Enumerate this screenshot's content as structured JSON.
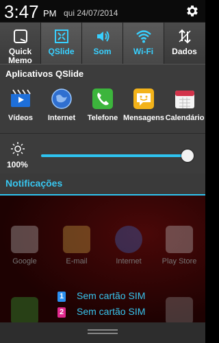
{
  "status": {
    "time": "3:47",
    "ampm": "PM",
    "date": "qui 24/07/2014"
  },
  "toggles": [
    {
      "label_lines": [
        "Quick",
        "Memo"
      ],
      "icon": "quick-memo-icon",
      "active": false
    },
    {
      "label_lines": [
        "QSlide"
      ],
      "icon": "qslide-icon",
      "active": true
    },
    {
      "label_lines": [
        "Som"
      ],
      "icon": "sound-icon",
      "active": true
    },
    {
      "label_lines": [
        "Wi-Fi"
      ],
      "icon": "wifi-icon",
      "active": true
    },
    {
      "label_lines": [
        "Dados"
      ],
      "icon": "data-icon",
      "active": false
    }
  ],
  "qslide": {
    "title": "Aplicativos QSlide",
    "apps": [
      {
        "label": "Vídeos",
        "icon": "videos-icon"
      },
      {
        "label": "Internet",
        "icon": "internet-icon"
      },
      {
        "label": "Telefone",
        "icon": "phone-icon"
      },
      {
        "label": "Mensagens",
        "icon": "messages-icon"
      },
      {
        "label": "Calendário",
        "icon": "calendar-icon"
      }
    ]
  },
  "brightness": {
    "label": "100%",
    "level": 1.0
  },
  "notifications": {
    "title": "Notificações"
  },
  "home_labels": [
    "Google",
    "E-mail",
    "Internet",
    "Play Store"
  ],
  "sims": [
    {
      "num": "1",
      "text": "Sem cartão SIM",
      "color": "#2a8ff0"
    },
    {
      "num": "2",
      "text": "Sem cartão SIM",
      "color": "#e0288c"
    }
  ],
  "colors": {
    "accent": "#2ec4f1"
  }
}
